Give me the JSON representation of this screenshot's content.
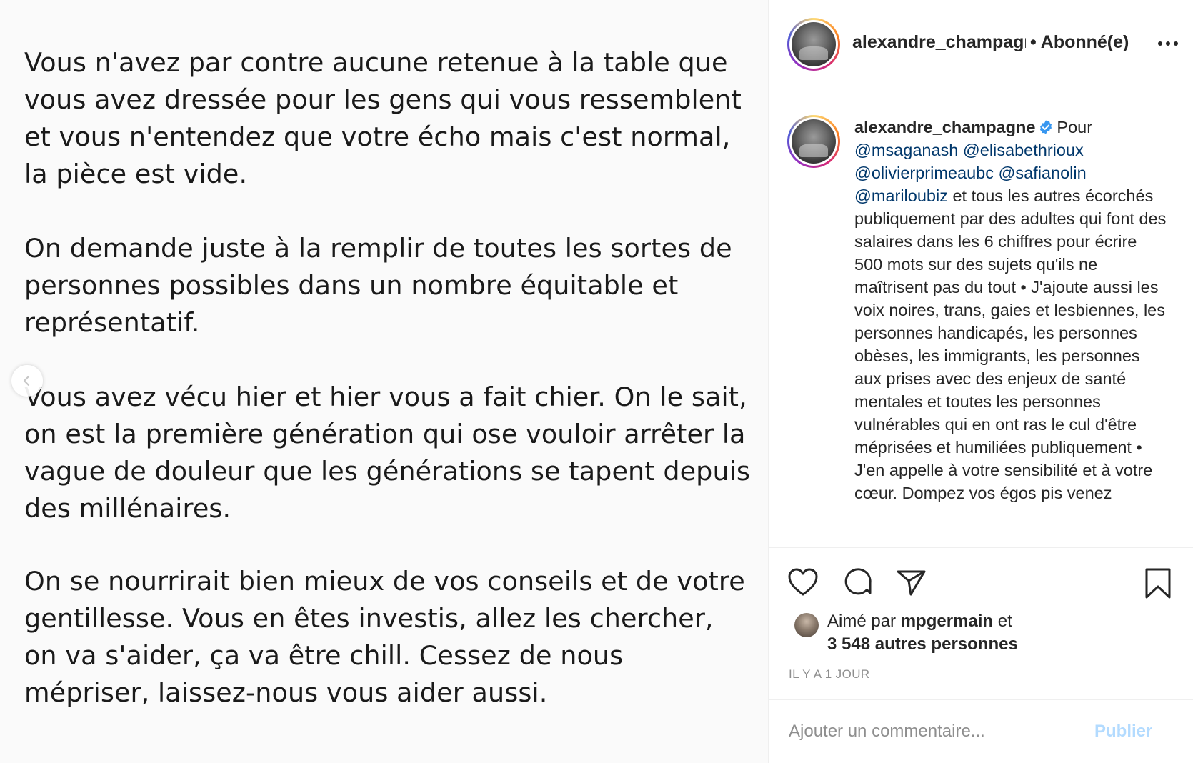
{
  "post_image": {
    "paragraphs": [
      "",
      "Vous n'avez par contre aucune retenue à la table que vous avez dressée pour les gens qui vous ressemblent et vous n'entendez que votre écho mais c'est normal, la pièce est vide.",
      "On demande juste à la remplir de toutes les sortes de personnes possibles dans un nombre équitable et représentatif.",
      "Vous avez vécu hier et hier vous a fait chier. On le sait, on est la première génération qui ose vouloir arrêter la vague de douleur que les générations se tapent depuis des millénaires.",
      "On se nourrirait bien mieux de vos conseils et de votre gentillesse. Vous en êtes investis, allez les chercher, on va s'aider, ça va être chill. Cessez de nous mépriser, laissez-nous vous aider aussi."
    ],
    "prev_icon": "chevron-left-icon"
  },
  "header": {
    "username": "alexandre_champagne",
    "separator": "•",
    "follow_status": "Abonné(e)",
    "more_icon": "more-horizontal-icon"
  },
  "caption": {
    "username": "alexandre_champagne",
    "verified_icon": "verified-badge-icon",
    "intro": "Pour",
    "mentions": [
      "@msaganash",
      "@elisabethrioux",
      "@olivierprimeaubc",
      "@safianolin",
      "@mariloubiz"
    ],
    "body": "et tous les autres écorchés publiquement par des adultes qui font des salaires dans les 6 chiffres pour écrire 500 mots sur des sujets qu'ils ne maîtrisent pas du tout • J'ajoute aussi les voix noires, trans, gaies et lesbiennes, les personnes handicapés, les personnes obèses, les immigrants, les personnes aux prises avec des enjeux de santé mentales et toutes les personnes vulnérables qui en ont ras le cul d'être méprisées et humiliées publiquement • J'en appelle à votre sensibilité et à votre cœur. Dompez vos égos pis venez"
  },
  "actions": {
    "like_icon": "heart-icon",
    "comment_icon": "comment-bubble-icon",
    "share_icon": "paper-plane-icon",
    "save_icon": "bookmark-icon"
  },
  "likes": {
    "prefix": "Aimé par",
    "liker": "mpgermain",
    "conjunction": "et",
    "others": "3 548 autres personnes"
  },
  "timestamp": "IL Y A 1 JOUR",
  "comment_box": {
    "placeholder": "Ajouter un commentaire...",
    "publish_label": "Publier"
  },
  "colors": {
    "mention": "#00376b",
    "publish_disabled": "#b3dbff",
    "verified": "#3897f0",
    "muted": "#8e8e8e"
  }
}
